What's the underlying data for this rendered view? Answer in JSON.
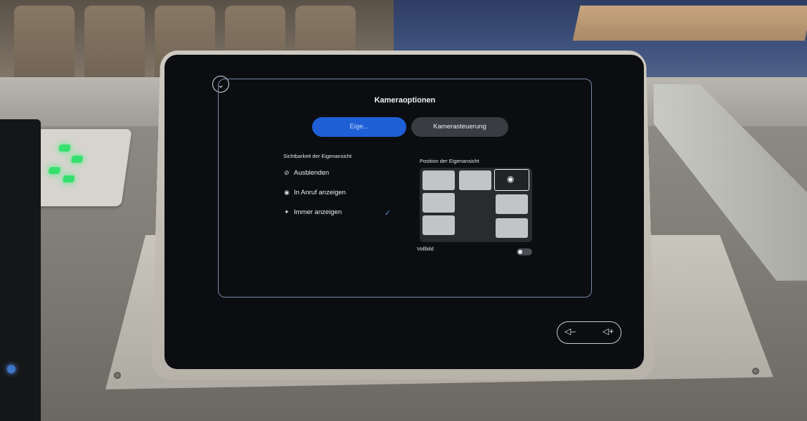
{
  "dialog": {
    "title": "Kameraoptionen"
  },
  "tabs": [
    {
      "label": "Eige...",
      "active": true
    },
    {
      "label": "Kamerasteuerung",
      "active": false
    }
  ],
  "visibility": {
    "heading": "Sichtbarkeit der Eigenansicht",
    "options": [
      {
        "label": "Ausblenden",
        "icon": "eye-slash-icon",
        "selected": false
      },
      {
        "label": "In Anruf anzeigen",
        "icon": "eye-icon",
        "selected": false
      },
      {
        "label": "Immer anzeigen",
        "icon": "pin-icon",
        "selected": true
      }
    ]
  },
  "position": {
    "heading": "Position der Eigenansicht",
    "selected_cell": "top-right"
  },
  "fullscreen": {
    "label": "Vollbild",
    "enabled": false
  },
  "colors": {
    "accent": "#1f5fd6",
    "screen_bg": "#0c0d10",
    "check": "#5f8fe8"
  }
}
